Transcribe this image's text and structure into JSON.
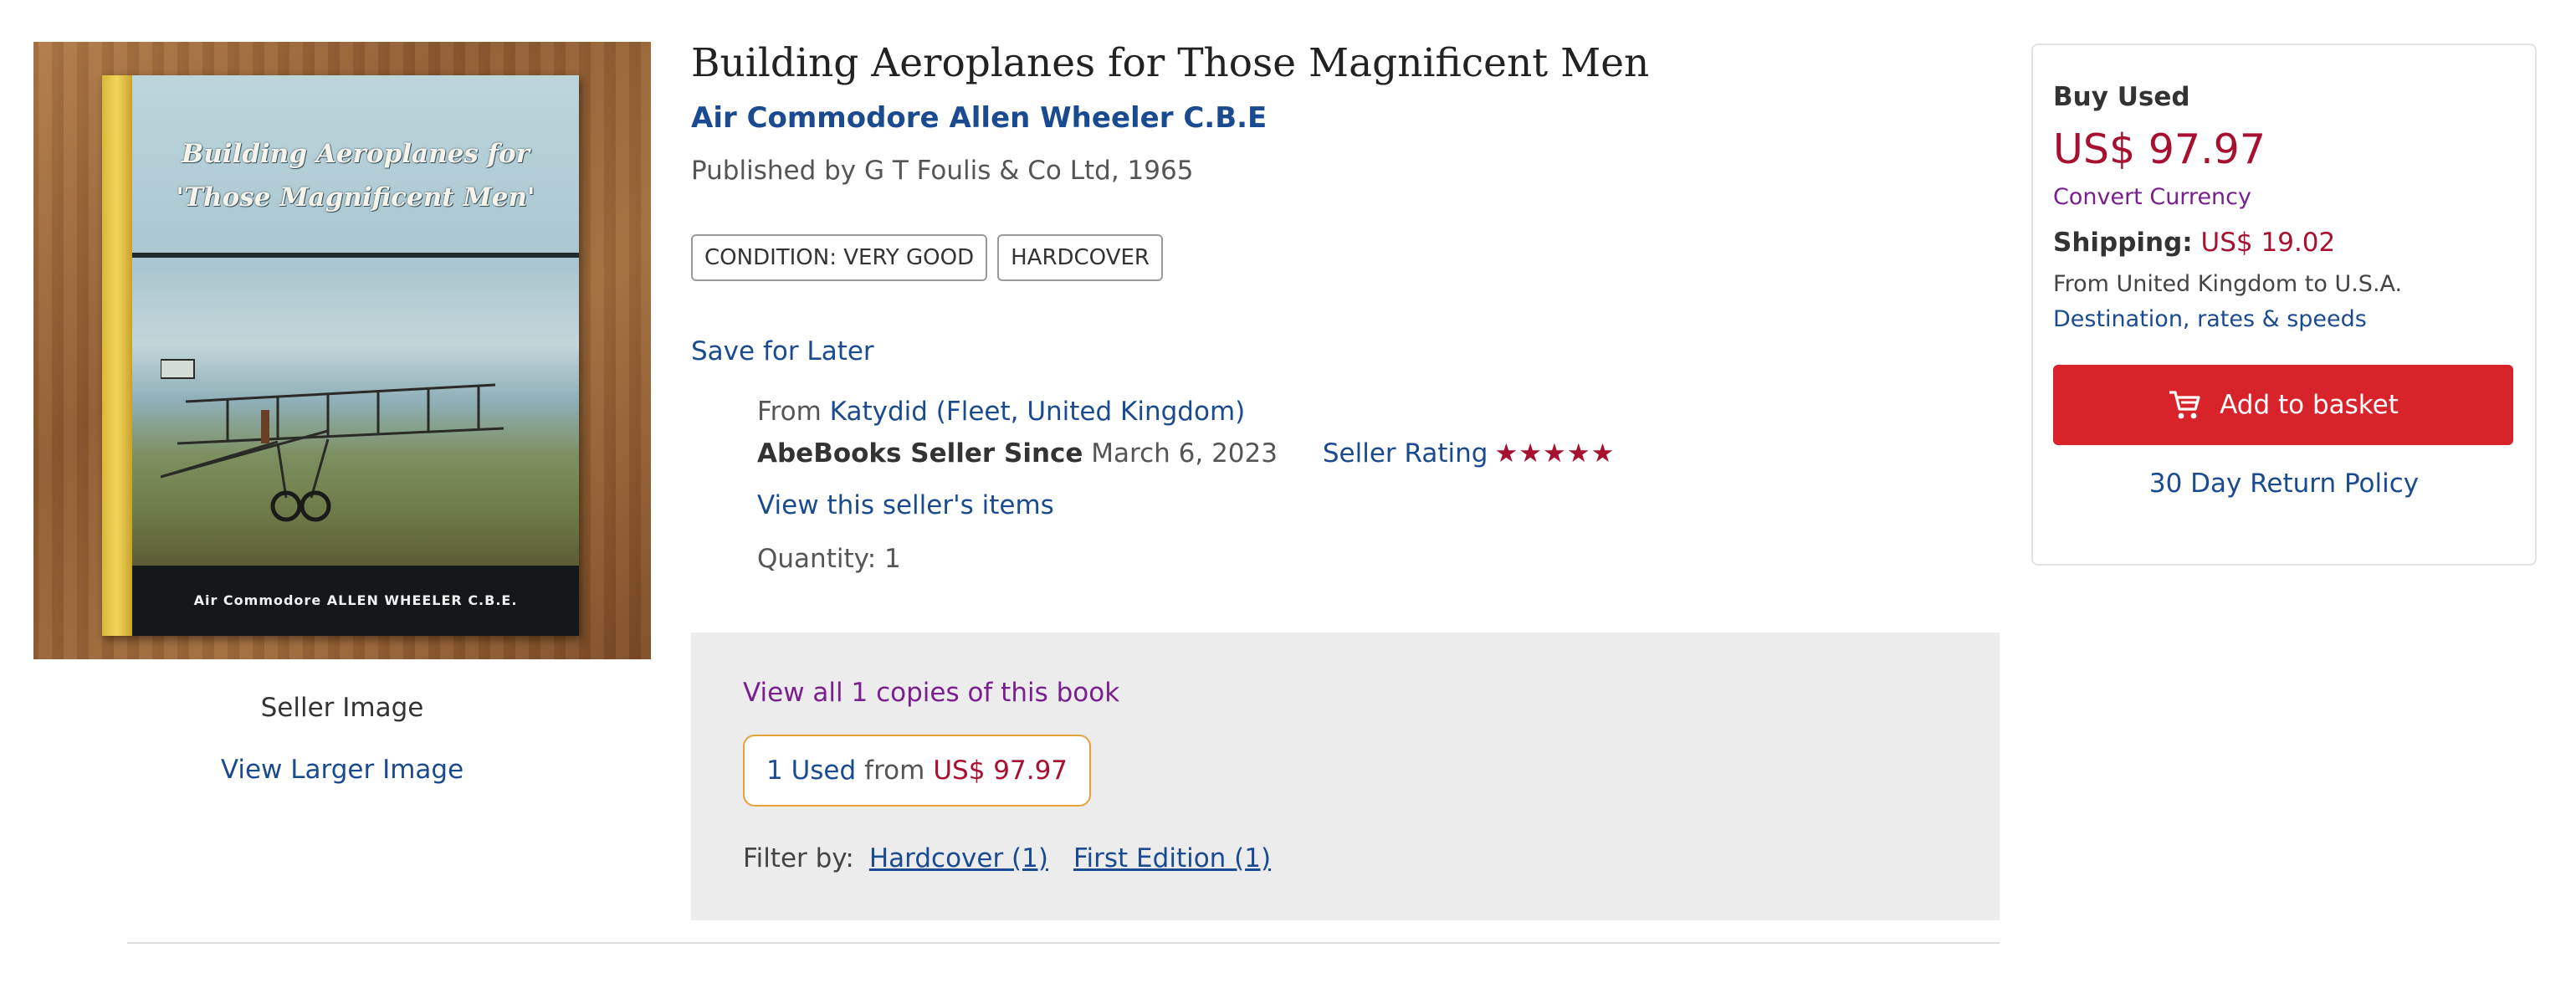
{
  "image": {
    "cover_title_line1": "Building Aeroplanes for",
    "cover_title_line2": "'Those Magnificent Men'",
    "cover_author": "Air Commodore ALLEN WHEELER C.B.E.",
    "seller_image_label": "Seller Image",
    "view_larger_label": "View Larger Image"
  },
  "book": {
    "title": "Building Aeroplanes for Those Magnificent Men",
    "author": "Air Commodore Allen Wheeler C.B.E",
    "published": "Published by G T Foulis & Co Ltd, 1965",
    "tags": [
      "CONDITION: VERY GOOD",
      "HARDCOVER"
    ],
    "save_later": "Save for Later"
  },
  "seller": {
    "from_label": "From",
    "name": "Katydid (Fleet, United Kingdom)",
    "since_label": "AbeBooks Seller Since",
    "since_date": "March 6, 2023",
    "rating_label": "Seller Rating",
    "rating_stars": "★★★★★",
    "rating_value": 5,
    "view_items": "View this seller's items",
    "quantity": "Quantity: 1"
  },
  "copies": {
    "view_all": "View all 1 copies of this book",
    "used_count": "1 Used",
    "from_label": "from",
    "used_price": "US$ 97.97",
    "filter_label": "Filter by:",
    "filters": [
      "Hardcover (1)",
      "First Edition (1)"
    ]
  },
  "buy": {
    "heading": "Buy Used",
    "price": "US$ 97.97",
    "convert_currency": "Convert Currency",
    "shipping_label": "Shipping:",
    "shipping_price": "US$ 19.02",
    "ship_from": "From United Kingdom to U.S.A.",
    "destination_link": "Destination, rates & speeds",
    "basket_button": "Add to basket",
    "return_policy": "30 Day Return Policy"
  },
  "colors": {
    "link_blue": "#1a4a8f",
    "price_red": "#a8102f",
    "button_red": "#d8232a",
    "visited_purple": "#7a1f8f",
    "chip_border_orange": "#e8a23a"
  },
  "icons": [
    "cart-icon",
    "star-icon"
  ]
}
